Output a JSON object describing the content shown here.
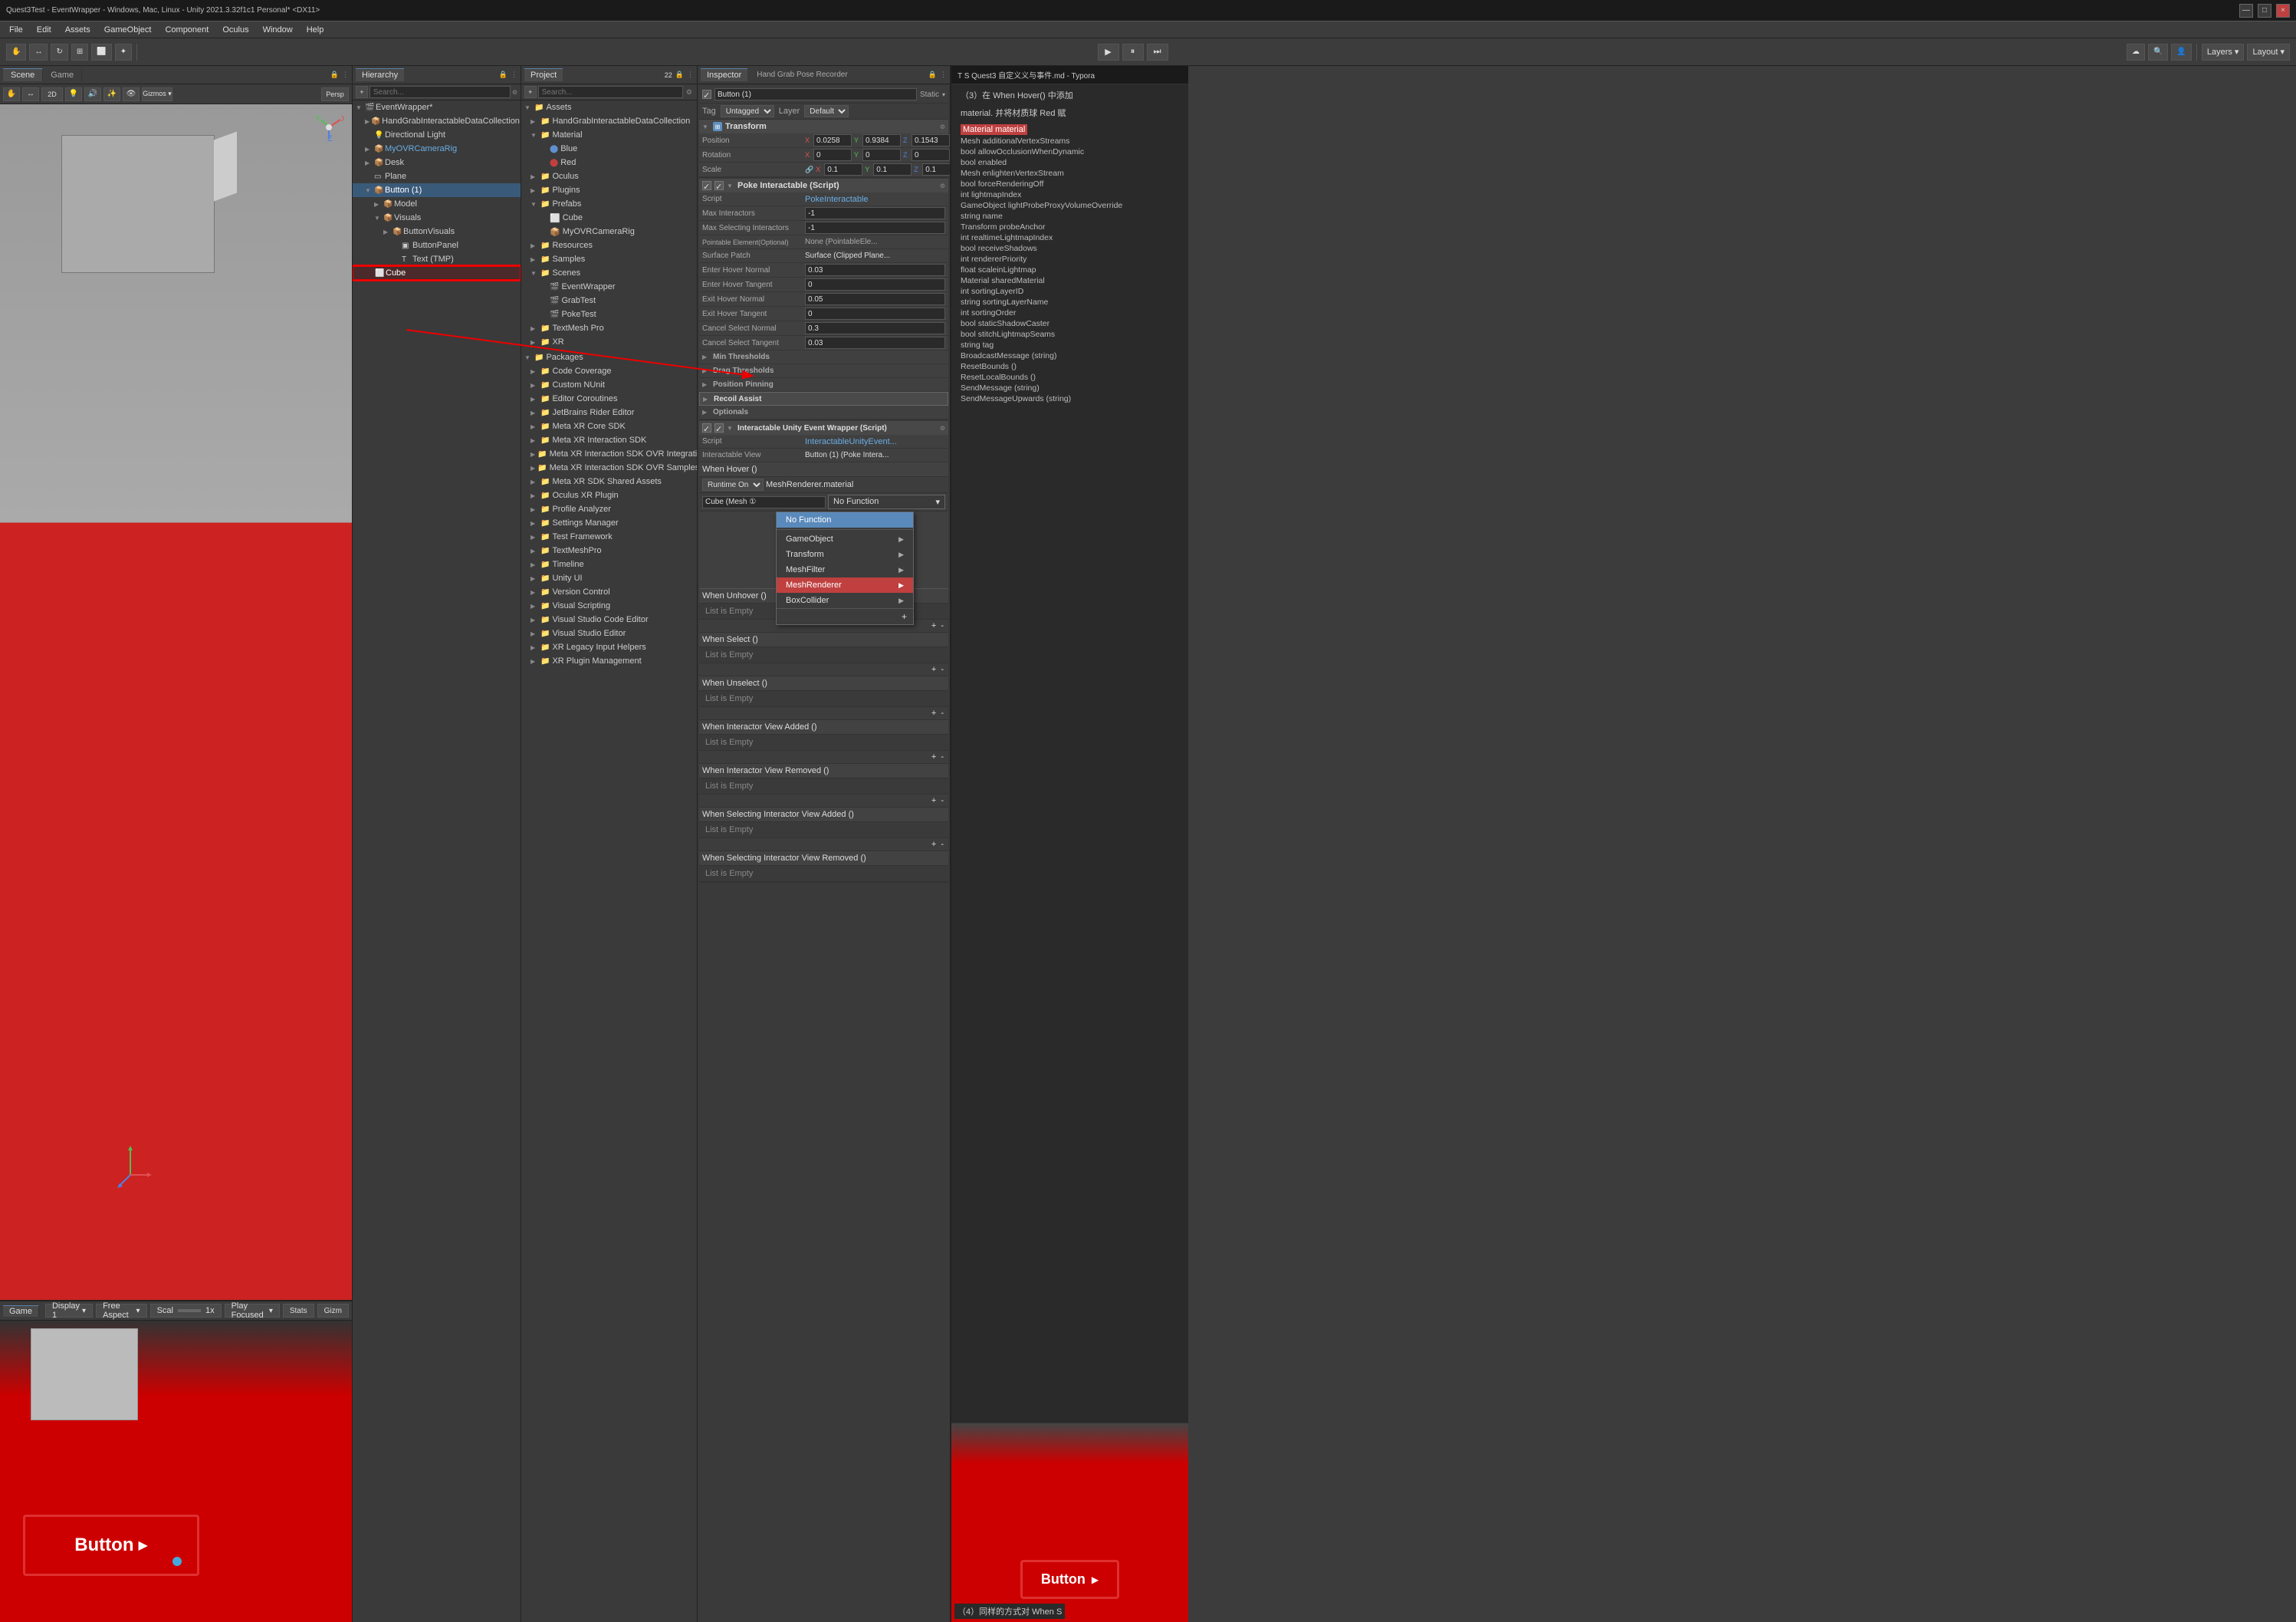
{
  "window": {
    "title": "Quest3Test - EventWrapper - Windows, Mac, Linux - Unity 2021.3.32f1c1 Personal* <DX11>",
    "controls": [
      "—",
      "□",
      "×"
    ]
  },
  "menubar": {
    "items": [
      "File",
      "Edit",
      "Assets",
      "GameObject",
      "Component",
      "Oculus",
      "Window",
      "Help"
    ]
  },
  "toolbar": {
    "play": "▶",
    "pause": "⏸",
    "step": "⏭",
    "layers_label": "Layers",
    "layout_label": "Layout",
    "cloud_icon": "☁",
    "search_icon": "🔍"
  },
  "scene": {
    "tab_label": "Scene",
    "game_tab_label": "Game",
    "toolbar_icons": [
      "✋",
      "↔",
      "↻",
      "⊞",
      "R",
      "2D",
      "💡",
      "🔊",
      "⚙"
    ],
    "viewport_bg": "#888"
  },
  "game": {
    "tab_label": "Game",
    "display_label": "Display 1",
    "aspect_label": "Free Aspect",
    "scale_label": "Scal",
    "scale_value": "1x",
    "play_focused_label": "Play Focused",
    "stats_label": "Stats",
    "gizmos_label": "Gizm",
    "button_text": "Button"
  },
  "hierarchy": {
    "tab_label": "Hierarchy",
    "search_placeholder": "Search...",
    "add_btn": "+",
    "items": [
      {
        "label": "EventWrapper*",
        "indent": 0,
        "arrow": "▼",
        "type": "scene"
      },
      {
        "label": "HandGrabInteractableDataCollection",
        "indent": 1,
        "arrow": "▶",
        "type": "object"
      },
      {
        "label": "Directional Light",
        "indent": 1,
        "arrow": "",
        "type": "object"
      },
      {
        "label": "MyOVRCameraRig",
        "indent": 1,
        "arrow": "▶",
        "type": "object",
        "color": "#6aade4"
      },
      {
        "label": "Desk",
        "indent": 1,
        "arrow": "▶",
        "type": "object"
      },
      {
        "label": "Plane",
        "indent": 1,
        "arrow": "",
        "type": "object"
      },
      {
        "label": "Button (1)",
        "indent": 1,
        "arrow": "▼",
        "type": "object"
      },
      {
        "label": "Model",
        "indent": 2,
        "arrow": "▶",
        "type": "object"
      },
      {
        "label": "Visuals",
        "indent": 2,
        "arrow": "▼",
        "type": "object"
      },
      {
        "label": "ButtonVisuals",
        "indent": 3,
        "arrow": "▶",
        "type": "object"
      },
      {
        "label": "ButtonPanel",
        "indent": 4,
        "arrow": "",
        "type": "object"
      },
      {
        "label": "Text (TMP)",
        "indent": 4,
        "arrow": "",
        "type": "object"
      },
      {
        "label": "Cube",
        "indent": 1,
        "arrow": "",
        "type": "object",
        "highlighted": true
      }
    ]
  },
  "project": {
    "tab_label": "Project",
    "search_placeholder": "Search...",
    "count": "22",
    "folders": [
      {
        "label": "Assets",
        "indent": 0,
        "arrow": "▼",
        "type": "folder"
      },
      {
        "label": "HandGrabInteractableDataCollection",
        "indent": 1,
        "arrow": "▶",
        "type": "folder"
      },
      {
        "label": "Material",
        "indent": 1,
        "arrow": "▼",
        "type": "folder"
      },
      {
        "label": "Blue",
        "indent": 2,
        "arrow": "",
        "type": "material",
        "color": "#6090d0"
      },
      {
        "label": "Red",
        "indent": 2,
        "arrow": "",
        "type": "material",
        "color": "#c04040"
      },
      {
        "label": "Oculus",
        "indent": 1,
        "arrow": "▶",
        "type": "folder"
      },
      {
        "label": "Plugins",
        "indent": 1,
        "arrow": "▶",
        "type": "folder"
      },
      {
        "label": "Prefabs",
        "indent": 1,
        "arrow": "▼",
        "type": "folder"
      },
      {
        "label": "Cube",
        "indent": 2,
        "arrow": "",
        "type": "prefab",
        "color": "#6090d0"
      },
      {
        "label": "MyOVRCameraRig",
        "indent": 2,
        "arrow": "",
        "type": "prefab",
        "color": "#6090d0"
      },
      {
        "label": "Resources",
        "indent": 1,
        "arrow": "▶",
        "type": "folder"
      },
      {
        "label": "Samples",
        "indent": 1,
        "arrow": "▶",
        "type": "folder"
      },
      {
        "label": "Scenes",
        "indent": 1,
        "arrow": "▼",
        "type": "folder"
      },
      {
        "label": "EventWrapper",
        "indent": 2,
        "arrow": "",
        "type": "scene"
      },
      {
        "label": "GrabTest",
        "indent": 2,
        "arrow": "",
        "type": "scene"
      },
      {
        "label": "PokeTest",
        "indent": 2,
        "arrow": "",
        "type": "scene"
      },
      {
        "label": "TextMesh Pro",
        "indent": 1,
        "arrow": "▶",
        "type": "folder"
      },
      {
        "label": "XR",
        "indent": 1,
        "arrow": "▶",
        "type": "folder"
      },
      {
        "label": "Packages",
        "indent": 0,
        "arrow": "▼",
        "type": "folder"
      },
      {
        "label": "Code Coverage",
        "indent": 1,
        "arrow": "▶",
        "type": "folder"
      },
      {
        "label": "Custom NUnit",
        "indent": 1,
        "arrow": "▶",
        "type": "folder"
      },
      {
        "label": "Editor Coroutines",
        "indent": 1,
        "arrow": "▶",
        "type": "folder"
      },
      {
        "label": "JetBrains Rider Editor",
        "indent": 1,
        "arrow": "▶",
        "type": "folder"
      },
      {
        "label": "Meta XR Core SDK",
        "indent": 1,
        "arrow": "▶",
        "type": "folder"
      },
      {
        "label": "Meta XR Interaction SDK",
        "indent": 1,
        "arrow": "▶",
        "type": "folder"
      },
      {
        "label": "Meta XR Interaction SDK OVR Integration",
        "indent": 1,
        "arrow": "▶",
        "type": "folder"
      },
      {
        "label": "Meta XR Interaction SDK OVR Samples",
        "indent": 1,
        "arrow": "▶",
        "type": "folder"
      },
      {
        "label": "Meta XR SDK Shared Assets",
        "indent": 1,
        "arrow": "▶",
        "type": "folder"
      },
      {
        "label": "Oculus XR Plugin",
        "indent": 1,
        "arrow": "▶",
        "type": "folder"
      },
      {
        "label": "Profile Analyzer",
        "indent": 1,
        "arrow": "▶",
        "type": "folder"
      },
      {
        "label": "Settings Manager",
        "indent": 1,
        "arrow": "▶",
        "type": "folder"
      },
      {
        "label": "Test Framework",
        "indent": 1,
        "arrow": "▶",
        "type": "folder"
      },
      {
        "label": "TextMeshPro",
        "indent": 1,
        "arrow": "▶",
        "type": "folder"
      },
      {
        "label": "Timeline",
        "indent": 1,
        "arrow": "▶",
        "type": "folder"
      },
      {
        "label": "Unity UI",
        "indent": 1,
        "arrow": "▶",
        "type": "folder"
      },
      {
        "label": "Version Control",
        "indent": 1,
        "arrow": "▶",
        "type": "folder"
      },
      {
        "label": "Visual Scripting",
        "indent": 1,
        "arrow": "▶",
        "type": "folder"
      },
      {
        "label": "Visual Studio Code Editor",
        "indent": 1,
        "arrow": "▶",
        "type": "folder"
      },
      {
        "label": "Visual Studio Editor",
        "indent": 1,
        "arrow": "▶",
        "type": "folder"
      },
      {
        "label": "XR Legacy Input Helpers",
        "indent": 1,
        "arrow": "▶",
        "type": "folder"
      },
      {
        "label": "XR Plugin Management",
        "indent": 1,
        "arrow": "▶",
        "type": "folder"
      }
    ]
  },
  "inspector": {
    "tab_label": "Inspector",
    "tab2_label": "Hand Grab Pose Recorder",
    "object_name": "Button (1)",
    "tag": "Untagged",
    "layer": "Default",
    "static_label": "Static",
    "transform": {
      "title": "Transform",
      "position": {
        "x": "0.0258",
        "y": "0.9384",
        "z": "0.1543"
      },
      "rotation": {
        "x": "0",
        "y": "0",
        "z": "0"
      },
      "scale": {
        "x": "0.1",
        "y": "0.1",
        "z": "0.1"
      }
    },
    "poke_interactable": {
      "title": "Poke Interactable (Script)",
      "script": "PokeInteractable",
      "max_interactors": "-1",
      "max_selecting": "-1",
      "pointable_element": "None (PointableEle...",
      "surface_patch": "Surface (Clipped Plane...",
      "enter_hover_normal": "0.03",
      "enter_hover_tangent": "0",
      "exit_hover_normal": "0.05",
      "exit_hover_tangent": "0",
      "cancel_select_normal": "0.3",
      "cancel_select_tangent": "0.03"
    },
    "min_thresholds": "Min Thresholds",
    "drag_thresholds": "Drag Thresholds",
    "position_pinning": "Position Pinning",
    "recoil_assist": "Recoil Assist",
    "optionals": "Optionals",
    "interactable_event_wrapper": {
      "title": "Interactable Unity Event Wrapper (Script)",
      "script": "InteractableUnityEvent...",
      "interactable_view_label": "Interactable View",
      "interactable_view_value": "Button (1) (Poke Intera...",
      "when_hover_label": "When Hover ()",
      "when_hover_runtime": "Runtime Only",
      "when_hover_event": "MeshRenderer.material",
      "when_hover_object": "Cube (Mesh ①",
      "no_function_label": "No Function",
      "when_unhover_label": "When Unhover ()",
      "when_unhover_empty": "List is Empty",
      "when_select_label": "When Select ()",
      "when_select_empty": "List is Empty",
      "when_unselect_label": "When Unselect ()",
      "when_unselect_empty": "List is Empty",
      "when_interactor_view_added_label": "When Interactor View Added ()",
      "when_interactor_view_added_empty": "List is Empty",
      "when_interactor_view_removed_label": "When Interactor View Removed ()",
      "when_interactor_view_removed_empty": "List is Empty",
      "when_selecting_interactor_view_added_label": "When Selecting Interactor View Added ()",
      "when_selecting_interactor_view_added_empty": "List is Empty",
      "when_selecting_interactor_view_removed_label": "When Selecting Interactor View Removed ()",
      "when_selecting_interactor_view_removed_empty": "List is Empty"
    }
  },
  "context_menu": {
    "items": [
      {
        "label": "No Function",
        "highlighted": true
      },
      {
        "label": "GameObject",
        "arrow": "▶"
      },
      {
        "label": "Transform",
        "arrow": "▶"
      },
      {
        "label": "MeshFilter",
        "arrow": "▶"
      },
      {
        "label": "MeshRenderer",
        "arrow": "▶",
        "highlighted": true
      },
      {
        "label": "BoxCollider",
        "arrow": "▶"
      }
    ],
    "add_btn": "+"
  },
  "right_panel": {
    "header": "T S Quest3 自定义义与事件.md - Typora",
    "text1": "（3）在 When Hover() 中添加",
    "text2": "material. 并将材质球 Red 赋",
    "button_preview_text": "Button",
    "text3": "（4）同样的方式对 When S"
  },
  "right_inspector": {
    "items": [
      "Mesh additionalVertexStreams",
      "bool allowOcclusionWhenDynamic",
      "bool enabled",
      "Mesh enlightenVertexStream",
      "bool forceRenderingOff",
      "int lightmapIndex",
      "GameObject lightProbeProxyVolumeOverride",
      "Material material",
      "string name",
      "Transform probeAnchor",
      "int realtimeLightmapIndex",
      "bool receiveShadows",
      "int rendererPriority",
      "float scaleinLightmap",
      "Material sharedMaterial",
      "int sortingLayerID",
      "string sortingLayerName",
      "int sortingOrder",
      "bool staticShadowCaster",
      "bool stitchLightmapSeams",
      "string tag",
      "BroadcastMessage (string)",
      "ResetBounds ()",
      "ResetLocalBounds ()",
      "SendMessage (string)",
      "SendMessageUpwards (string)"
    ]
  },
  "colors": {
    "accent": "#5b7fa6",
    "highlight": "#c04040",
    "selected": "#3a5a7a",
    "bg_dark": "#2a2a2a",
    "bg_mid": "#3a3a3a",
    "bg_light": "#4a4a4a"
  }
}
